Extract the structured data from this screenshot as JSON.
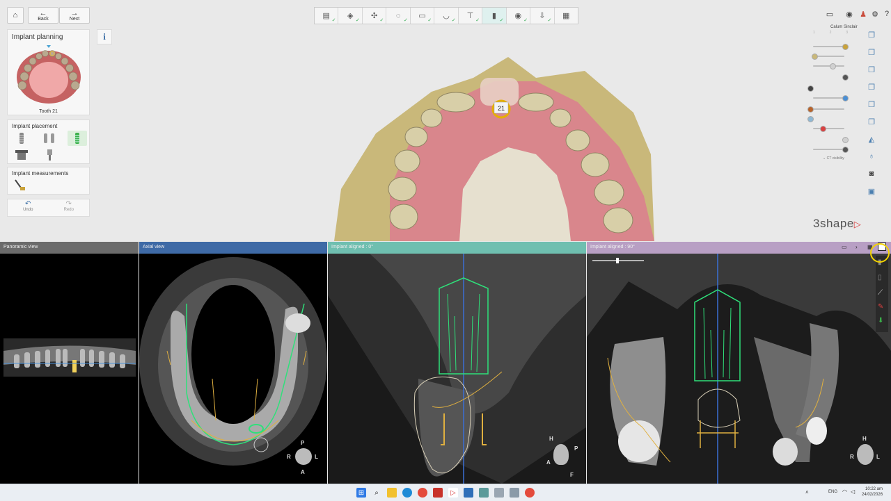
{
  "nav": {
    "home_icon": "home-icon",
    "back_label": "Back",
    "next_label": "Next"
  },
  "workflow": {
    "steps": [
      "order-icon",
      "scan-icon",
      "segment-icon",
      "align-icon",
      "model-icon",
      "crown-icon",
      "abutment-icon",
      "implant-icon",
      "guide-icon",
      "export-icon",
      "final-icon"
    ],
    "active_index": 7
  },
  "left_panel": {
    "title": "Implant planning",
    "info_icon": "i",
    "tooth_label": "Tooth 21",
    "placement_title": "Implant placement",
    "measurements_title": "Implant measurements",
    "undo_label": "Undo",
    "redo_label": "Redo"
  },
  "viewport": {
    "tooth_badge": "21",
    "brand": "3shape"
  },
  "right_panel": {
    "user_name": "Calum Sinclair",
    "ct_visibility_label": "CT visibility",
    "slider_ticks": [
      "1",
      "2",
      "3"
    ]
  },
  "views": {
    "panoramic": {
      "title": "Panoramic view",
      "color": "#6b6b6b"
    },
    "axial": {
      "title": "Axial view",
      "color": "#3e6aa6"
    },
    "aligned0": {
      "title": "Implant aligned : 0°",
      "color": "#6fbfb0"
    },
    "aligned90": {
      "title": "Implant aligned : 90°",
      "color": "#b89fc4"
    },
    "orient_axial": [
      "P",
      "R",
      "L",
      "A"
    ],
    "orient_0": [
      "H",
      "P",
      "A",
      "F"
    ],
    "orient_90": [
      "H",
      "R",
      "L"
    ]
  },
  "taskbar": {
    "lang": "ENG",
    "time": "10:22 am",
    "date": "24/02/2026"
  },
  "colors": {
    "accent": "#2aa84a",
    "implant_outline": "#2fe07a",
    "nerve_outline": "#e0b040",
    "brand_red": "#d94040"
  }
}
